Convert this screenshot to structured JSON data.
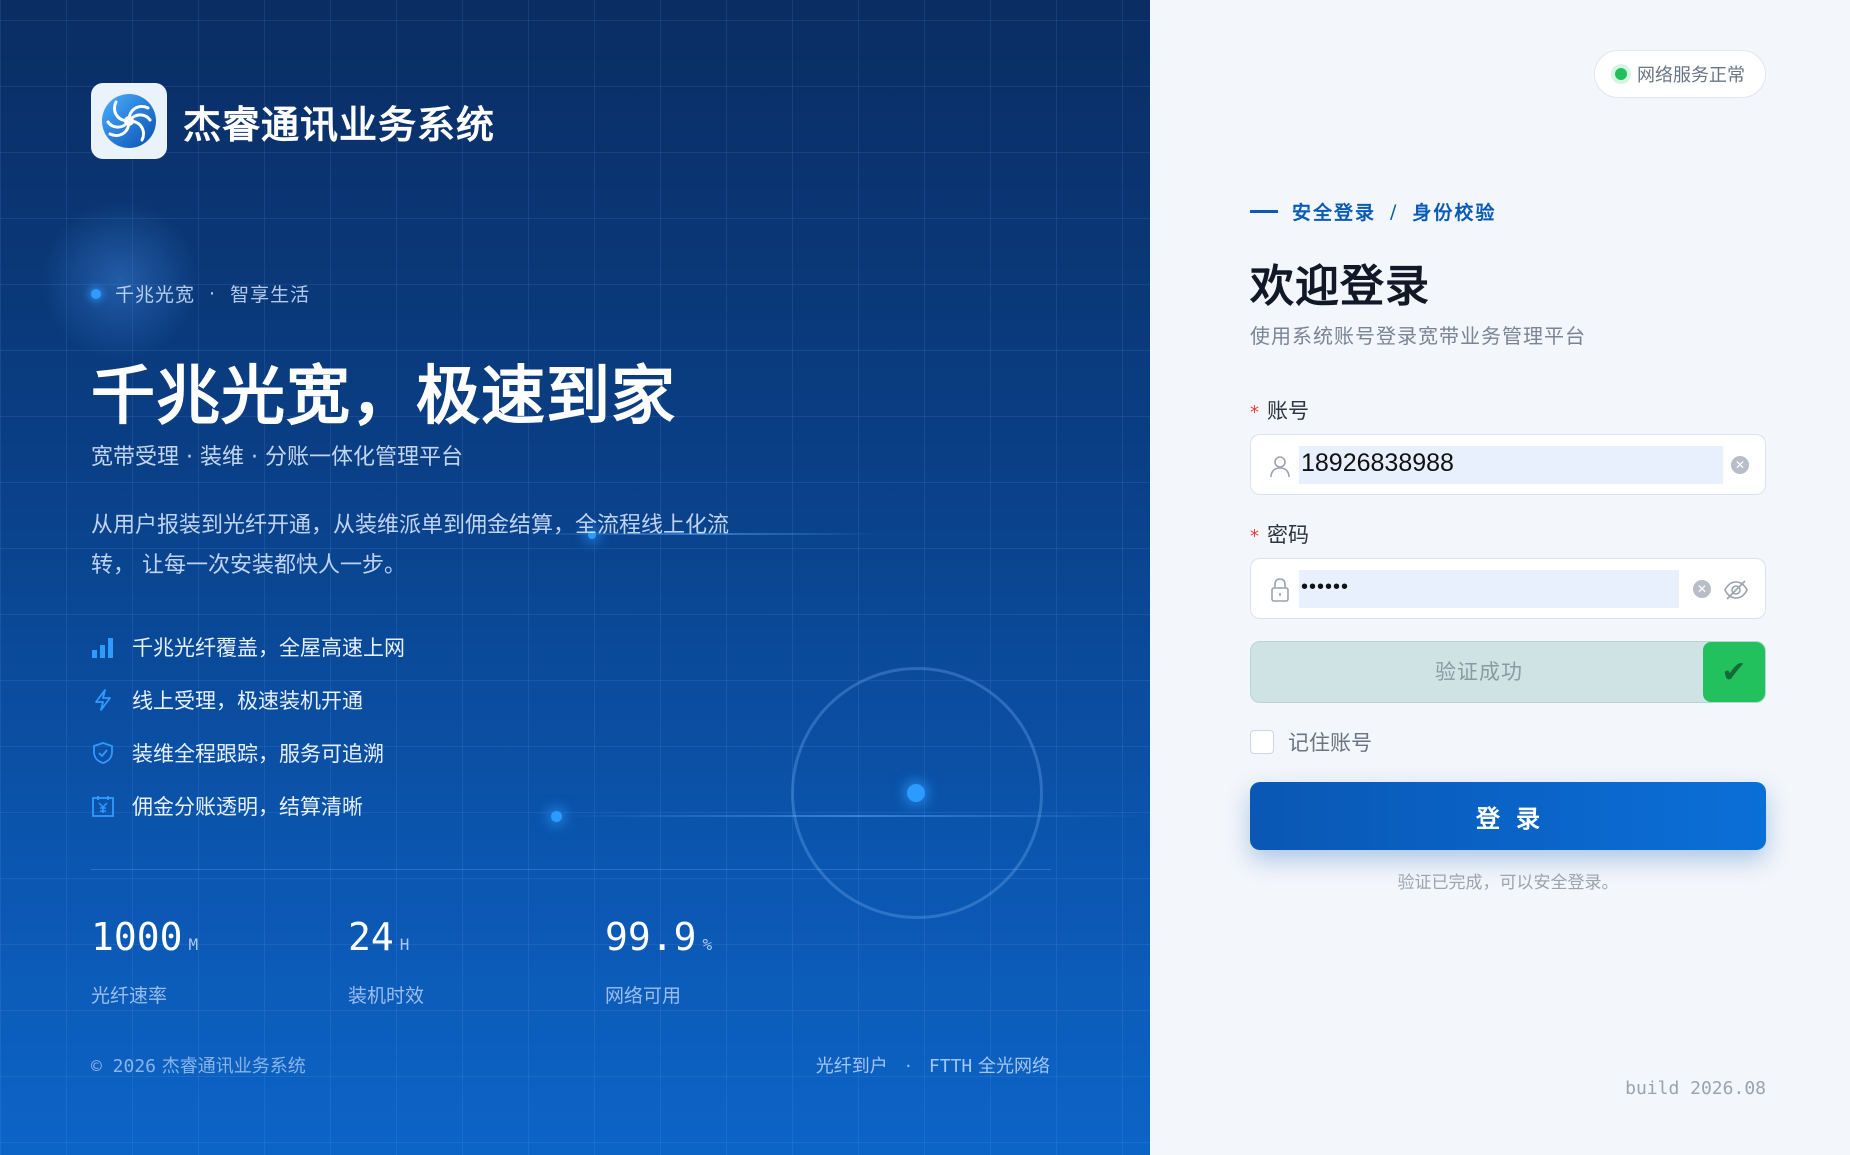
{
  "brand": {
    "name": "杰睿通讯业务系统",
    "logo_icon": "swirl-logo-icon"
  },
  "hero": {
    "tagline_part1": "千兆光宽",
    "tagline_sep": "·",
    "tagline_part2": "智享生活",
    "title": "千兆光宽，极速到家",
    "subtitle": "宽带受理 · 装维 · 分账一体化管理平台",
    "description": "从用户报装到光纤开通，从装维派单到佣金结算，全流程线上化流转， 让每一次安装都快人一步。"
  },
  "features": [
    {
      "icon": "signal-bars-icon",
      "label": "千兆光纤覆盖，全屋高速上网"
    },
    {
      "icon": "lightning-icon",
      "label": "线上受理，极速装机开通"
    },
    {
      "icon": "shield-check-icon",
      "label": "装维全程跟踪，服务可追溯"
    },
    {
      "icon": "yen-calendar-icon",
      "label": "佣金分账透明，结算清晰"
    }
  ],
  "stats": [
    {
      "value": "1000",
      "unit": "M",
      "label": "光纤速率"
    },
    {
      "value": "24",
      "unit": "H",
      "label": "装机时效"
    },
    {
      "value": "99.9",
      "unit": "%",
      "label": "网络可用"
    }
  ],
  "footer": {
    "copyright_year": "© 2026",
    "copyright_name": "杰睿通讯业务系统",
    "right_part1": "光纤到户",
    "right_sep": "·",
    "right_ftth": "FTTH",
    "right_part2": "全光网络"
  },
  "status": {
    "text": "网络服务正常",
    "color": "#20c05c"
  },
  "login": {
    "crumb_a": "安全登录",
    "crumb_sep": "/",
    "crumb_b": "身份校验",
    "title": "欢迎登录",
    "subtitle": "使用系统账号登录宽带业务管理平台",
    "account_label": "账号",
    "account_value": "18926838988",
    "password_label": "密码",
    "password_value": "••••••",
    "required_mark": "*",
    "verify_text": "验证成功",
    "verify_check": "✔",
    "remember_label": "记住账号",
    "remember_checked": false,
    "submit_label": "登录",
    "hint": "验证已完成，可以安全登录。"
  },
  "build": "build 2026.08",
  "colors": {
    "accent": "#0a5bb8",
    "success": "#22c15d",
    "required": "#e5403a"
  }
}
